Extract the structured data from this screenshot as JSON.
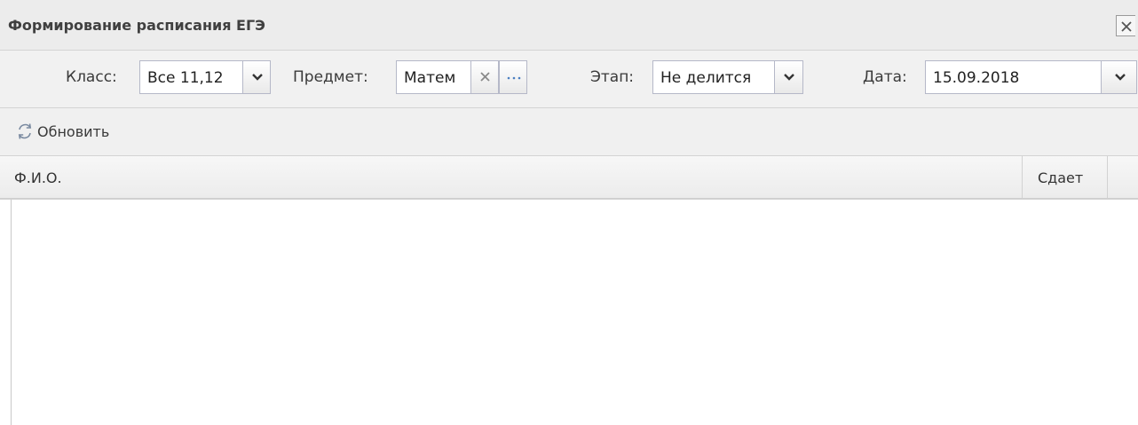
{
  "window": {
    "title": "Формирование расписания ЕГЭ"
  },
  "filters": {
    "class_label": "Класс:",
    "class_value": "Все 11,12",
    "subject_label": "Предмет:",
    "subject_value": "Матем",
    "stage_label": "Этап:",
    "stage_value": "Не делится",
    "date_label": "Дата:",
    "date_value": "15.09.2018"
  },
  "toolbar": {
    "refresh_label": "Обновить"
  },
  "grid": {
    "columns": [
      "Ф.И.О.",
      "Сдает"
    ],
    "rows": []
  },
  "icons": {
    "close": "close-icon",
    "dropdown": "chevron-down-icon",
    "clear": "clear-icon",
    "browse": "ellipsis-icon",
    "refresh": "refresh-icon"
  },
  "colors": {
    "titlebar_bg": "#ececec",
    "field_border": "#b5b8c8",
    "text": "#3a3a3a"
  }
}
